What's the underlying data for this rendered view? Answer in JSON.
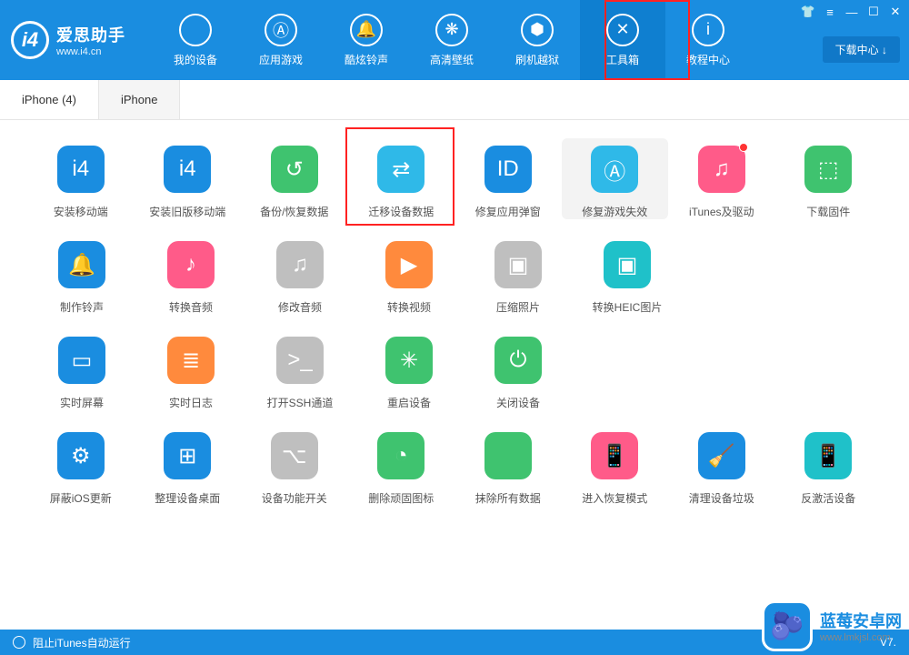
{
  "app": {
    "name": "爱思助手",
    "url": "www.i4.cn",
    "logo_letter": "i4"
  },
  "window_controls": {
    "download_center": "下载中心 ↓"
  },
  "nav": [
    {
      "label": "我的设备",
      "icon": ""
    },
    {
      "label": "应用游戏",
      "icon": "Ⓐ"
    },
    {
      "label": "酷炫铃声",
      "icon": "🔔"
    },
    {
      "label": "高清壁纸",
      "icon": "❋"
    },
    {
      "label": "刷机越狱",
      "icon": "⬢"
    },
    {
      "label": "工具箱",
      "icon": "✕"
    },
    {
      "label": "教程中心",
      "icon": "i"
    }
  ],
  "nav_active_index": 5,
  "tabs": [
    {
      "label": "iPhone (4)",
      "active": true
    },
    {
      "label": "iPhone",
      "active": false
    }
  ],
  "tool_rows": [
    [
      {
        "label": "安装移动端",
        "color": "c-blue",
        "glyph": "i4"
      },
      {
        "label": "安装旧版移动端",
        "color": "c-blue",
        "glyph": "i4"
      },
      {
        "label": "备份/恢复数据",
        "color": "c-green",
        "glyph": "↺"
      },
      {
        "label": "迁移设备数据",
        "color": "c-cyan",
        "glyph": "⇄"
      },
      {
        "label": "修复应用弹窗",
        "color": "c-blue",
        "glyph": "ID"
      },
      {
        "label": "修复游戏失效",
        "color": "c-cyan",
        "glyph": "Ⓐ",
        "hovered": true
      },
      {
        "label": "iTunes及驱动",
        "color": "c-pink",
        "glyph": "♫",
        "dot": true
      },
      {
        "label": "下载固件",
        "color": "c-green",
        "glyph": "⬚"
      }
    ],
    [
      {
        "label": "制作铃声",
        "color": "c-blue",
        "glyph": "🔔"
      },
      {
        "label": "转换音频",
        "color": "c-pink",
        "glyph": "♪"
      },
      {
        "label": "修改音频",
        "color": "c-gray",
        "glyph": "♫"
      },
      {
        "label": "转换视频",
        "color": "c-orange",
        "glyph": "▶"
      },
      {
        "label": "压缩照片",
        "color": "c-gray",
        "glyph": "▣"
      },
      {
        "label": "转换HEIC图片",
        "color": "c-teal",
        "glyph": "▣"
      }
    ],
    [
      {
        "label": "实时屏幕",
        "color": "c-blue",
        "glyph": "▭"
      },
      {
        "label": "实时日志",
        "color": "c-orange",
        "glyph": "≣"
      },
      {
        "label": "打开SSH通道",
        "color": "c-gray",
        "glyph": ">_"
      },
      {
        "label": "重启设备",
        "color": "c-green",
        "glyph": "✳"
      },
      {
        "label": "关闭设备",
        "color": "c-green",
        "glyph": "⏻"
      }
    ],
    [
      {
        "label": "屏蔽iOS更新",
        "color": "c-blue",
        "glyph": "⚙"
      },
      {
        "label": "整理设备桌面",
        "color": "c-blue",
        "glyph": "⊞"
      },
      {
        "label": "设备功能开关",
        "color": "c-gray",
        "glyph": "⌥"
      },
      {
        "label": "删除顽固图标",
        "color": "c-green",
        "glyph": "◔"
      },
      {
        "label": "抹除所有数据",
        "color": "c-green",
        "glyph": ""
      },
      {
        "label": "进入恢复模式",
        "color": "c-pink",
        "glyph": "📱"
      },
      {
        "label": "清理设备垃圾",
        "color": "c-blue",
        "glyph": "🧹"
      },
      {
        "label": "反激活设备",
        "color": "c-teal",
        "glyph": "📱"
      }
    ]
  ],
  "footer": {
    "left": "阻止iTunes自动运行",
    "version": "V7."
  },
  "watermark": {
    "title": "蓝莓安卓网",
    "sub": "www.lmkjsl.com",
    "icon": "🫐"
  }
}
